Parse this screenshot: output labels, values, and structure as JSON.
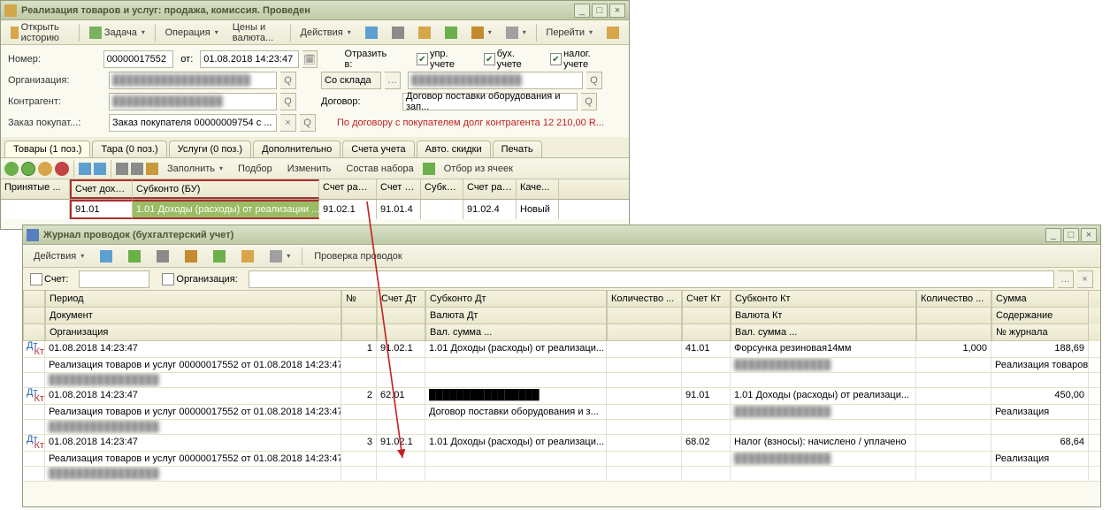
{
  "win1": {
    "title": "Реализация товаров и услуг: продажа, комиссия. Проведен",
    "toolbar": {
      "history": "Открыть историю",
      "task": "Задача",
      "operation": "Операция",
      "prices": "Цены и валюта...",
      "actions": "Действия",
      "goto": "Перейти"
    },
    "form": {
      "number_label": "Номер:",
      "number": "00000017552",
      "from": "от:",
      "date": "01.08.2018 14:23:47",
      "reflect_label": "Отразить в:",
      "chk1": "упр. учете",
      "chk2": "бух. учете",
      "chk3": "налог. учете",
      "org_label": "Организация:",
      "org_val": "████████████████████",
      "fromwh_label": "Со склада",
      "wh_val": "████████████████",
      "counterparty_label": "Контрагент:",
      "cp_val": "████████████████",
      "contract_label": "Договор:",
      "contract_val": "Договор поставки оборудования и зап...",
      "order_label": "Заказ покупат...:",
      "order_val": "Заказ покупателя 00000009754 с ...",
      "debt_text": "По договору с покупателем долг контрагента 12 210,00 R..."
    },
    "tabs": [
      "Товары (1 поз.)",
      "Тара (0 поз.)",
      "Услуги (0 поз.)",
      "Дополнительно",
      "Счета учета",
      "Авто. скидки",
      "Печать"
    ],
    "gridbar": {
      "fill": "Заполнить",
      "select": "Подбор",
      "edit": "Изменить",
      "content": "Состав набора",
      "filter": "Отбор из ячеек"
    },
    "cols": {
      "accepted": "Принятые ...",
      "income": "Счет доход...",
      "subconto": "Субконто (БУ)",
      "expense": "Счет расх...",
      "d": "Счет д...",
      "subk": "Субко...",
      "ras": "Счет рас...",
      "kach": "Каче..."
    },
    "row": {
      "income": "91.01",
      "subconto": "1.01 Доходы (расходы) от реализации ...",
      "expense": "91.02.1",
      "d": "91.01.4",
      "ras": "91.02.4",
      "kach": "Новый"
    }
  },
  "win2": {
    "title": "Журнал проводок (бухгалтерский учет)",
    "toolbar": {
      "actions": "Действия",
      "check": "Проверка проводок"
    },
    "filter": {
      "acct": "Счет:",
      "org": "Организация:"
    },
    "hdr": {
      "period": "Период",
      "no": "№",
      "accdt": "Счет Дт",
      "subdt": "Субконто Дт",
      "qtydt": "Количество ...",
      "acckt": "Счет Кт",
      "subkt": "Субконто Кт",
      "qtykt": "Количество ...",
      "sum": "Сумма",
      "doc": "Документ",
      "valdt": "Валюта Дт",
      "valkt": "Валюта Кт",
      "content": "Содержание",
      "org": "Организация",
      "vsumdt": "Вал. сумма ...",
      "vsumkt": "Вал. сумма ...",
      "journal": "№ журнала"
    },
    "rows": [
      {
        "period": "01.08.2018 14:23:47",
        "no": "1",
        "accdt": "91.02.1",
        "subdt": "1.01 Доходы (расходы) от реализаци...",
        "acckt": "41.01",
        "subkt": "Форсунка  резиновая14мм",
        "qty": "1,000",
        "sum": "188,69",
        "doc": "Реализация товаров и услуг 00000017552 от 01.08.2018 14:23:47",
        "content": "Реализация товаров"
      },
      {
        "period": "01.08.2018 14:23:47",
        "no": "2",
        "accdt": "62.01",
        "subdt": "████████████████",
        "acckt": "91.01",
        "subkt": "1.01 Доходы (расходы) от реализаци...",
        "qty": "",
        "sum": "450,00",
        "doc": "Реализация товаров и услуг 00000017552 от 01.08.2018 14:23:47",
        "subdt2": "Договор поставки оборудования и з...",
        "content": "Реализация"
      },
      {
        "period": "01.08.2018 14:23:47",
        "no": "3",
        "accdt": "91.02.1",
        "subdt": "1.01 Доходы (расходы) от реализаци...",
        "acckt": "68.02",
        "subkt": "Налог (взносы): начислено / уплачено",
        "qty": "",
        "sum": "68,64",
        "doc": "Реализация товаров и услуг 00000017552 от 01.08.2018 14:23:47",
        "content": "Реализация"
      }
    ]
  }
}
